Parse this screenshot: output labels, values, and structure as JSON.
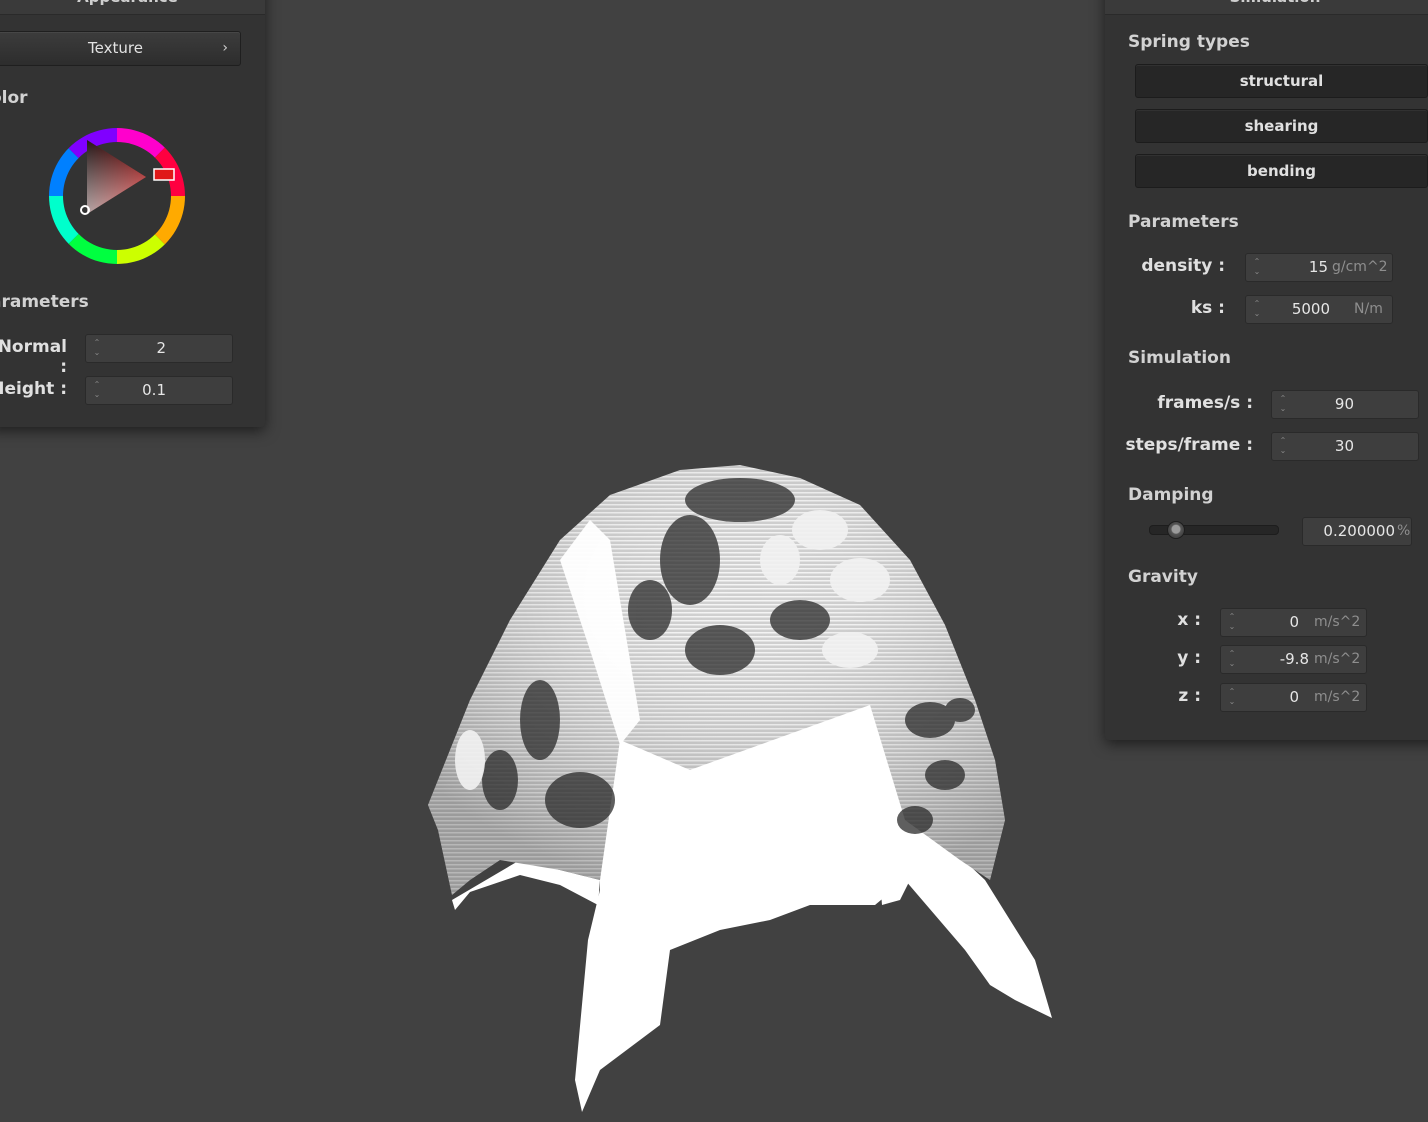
{
  "appearance_panel": {
    "title": "Appearance",
    "texture_button": "Texture",
    "texture_chevron": "›",
    "color_label": "olor",
    "parameters_label": "arameters",
    "normal_label": "Normal :",
    "normal_value": "2",
    "height_label": "Height :",
    "height_value": "0.1",
    "selected_color": "#ff0000"
  },
  "simulation_panel": {
    "title": "Simulation",
    "spring_types_label": "Spring types",
    "spring_buttons": [
      "structural",
      "shearing",
      "bending"
    ],
    "parameters_label": "Parameters",
    "density_label": "density :",
    "density_value": "15",
    "density_unit": "g/cm^2",
    "ks_label": "ks :",
    "ks_value": "5000",
    "ks_unit": "N/m",
    "simulation_label": "Simulation",
    "fps_label": "frames/s :",
    "fps_value": "90",
    "steps_label": "steps/frame :",
    "steps_value": "30",
    "damping_label": "Damping",
    "damping_value": "0.200000",
    "damping_unit": "%",
    "damping_fraction": 0.2,
    "gravity_label": "Gravity",
    "gx_label": "x :",
    "gx_value": "0",
    "gy_label": "y :",
    "gy_value": "-9.8",
    "gz_label": "z :",
    "gz_value": "0",
    "gravity_unit": "m/s^2"
  },
  "viewport": {
    "background": "#414141",
    "object": "cloth-draped-over-sphere"
  }
}
